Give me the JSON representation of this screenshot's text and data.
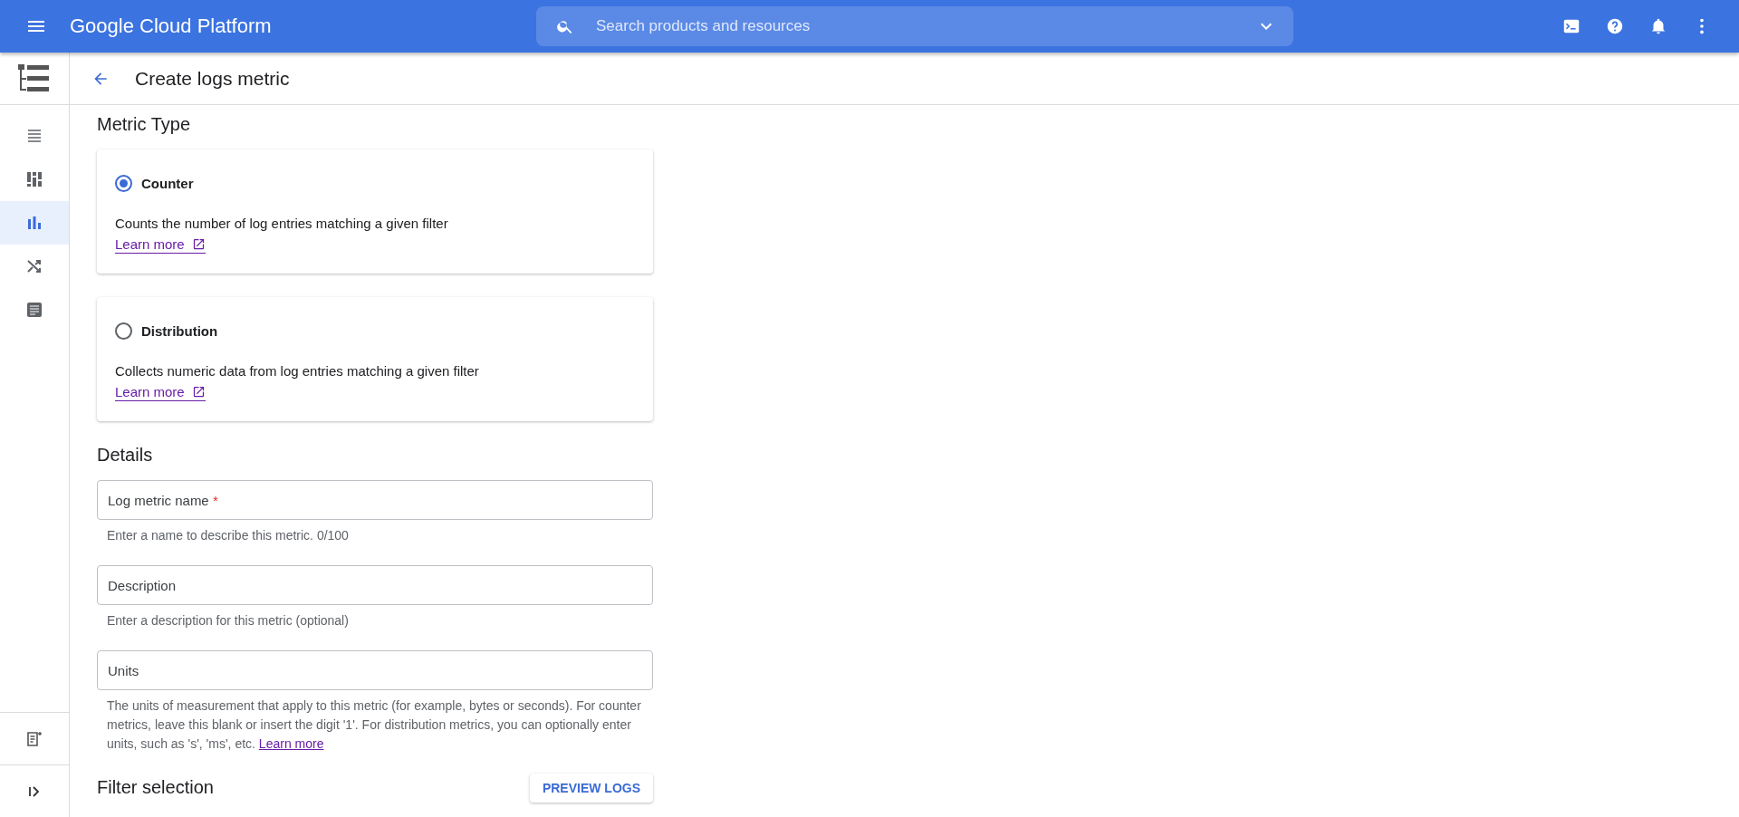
{
  "topbar": {
    "title": "Google Cloud Platform",
    "search": {
      "placeholder": "Search products and resources"
    }
  },
  "sidebar": {
    "items": [
      {
        "selected": false
      },
      {
        "selected": false
      },
      {
        "selected": true
      },
      {
        "selected": false
      },
      {
        "selected": false
      }
    ]
  },
  "page": {
    "title": "Create logs metric"
  },
  "metric_type": {
    "heading": "Metric Type",
    "options": [
      {
        "label": "Counter",
        "selected": true,
        "description": "Counts the number of log entries matching a given filter",
        "link": "Learn more"
      },
      {
        "label": "Distribution",
        "selected": false,
        "description": "Collects numeric data from log entries matching a given filter",
        "link": "Learn more"
      }
    ]
  },
  "details": {
    "heading": "Details",
    "fields": [
      {
        "placeholder": "Log metric name",
        "required_mark": "*",
        "helper": "Enter a name to describe this metric. 0/100"
      },
      {
        "placeholder": "Description",
        "helper": "Enter a description for this metric (optional)"
      },
      {
        "placeholder": "Units",
        "helper": "The units of measurement that apply to this metric (for example, bytes or seconds). For counter metrics, leave this blank or insert the digit '1'. For distribution metrics, you can optionally enter units, such as 's', 'ms', etc.",
        "helper_link": "Learn more"
      }
    ]
  },
  "filter_selection": {
    "heading": "Filter selection",
    "button": "PREVIEW LOGS"
  }
}
